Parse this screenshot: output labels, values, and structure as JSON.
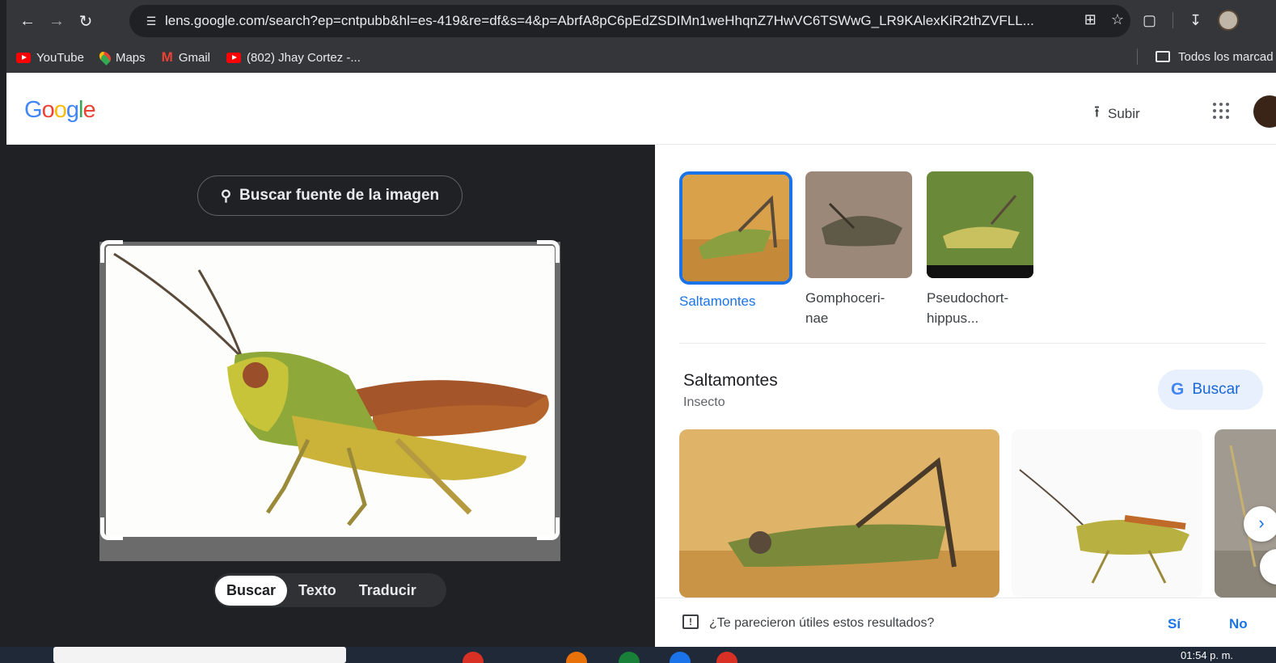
{
  "browser": {
    "url": "lens.google.com/search?ep=cntpubb&hl=es-419&re=df&s=4&p=AbrfA8pC6pEdZSDIMn1weHhqnZ7HwVC6TSWwG_LR9KAlexKiR2thZVFLL...",
    "bookmarks": [
      {
        "label": "YouTube",
        "icon": "youtube-icon"
      },
      {
        "label": "Maps",
        "icon": "maps-icon"
      },
      {
        "label": "Gmail",
        "icon": "gmail-icon"
      },
      {
        "label": "(802) Jhay Cortez -...",
        "icon": "youtube-icon"
      }
    ],
    "all_bookmarks_label": "Todos los marcad"
  },
  "header": {
    "logo": "Google",
    "upload_label": "Subir"
  },
  "left_pane": {
    "source_button": "Buscar fuente de la imagen",
    "modes": [
      "Buscar",
      "Texto",
      "Traducir"
    ],
    "active_mode": "Buscar"
  },
  "results": {
    "chips": [
      {
        "label": "Saltamontes",
        "active": true
      },
      {
        "label": "Gomphoceri-\nnae",
        "active": false
      },
      {
        "label": "Pseudochort-\nhippus...",
        "active": false
      }
    ],
    "knowledge_panel": {
      "title": "Saltamontes",
      "subtitle": "Insecto",
      "search_button": "Buscar"
    },
    "feedback": {
      "question": "¿Te parecieron útiles estos resultados?",
      "yes": "Sí",
      "no": "No"
    }
  },
  "taskbar": {
    "clock": "01:54 p. m."
  },
  "colors": {
    "accent": "#1a73e8",
    "dark_bg": "#202124",
    "chrome_bar": "#35363a"
  }
}
